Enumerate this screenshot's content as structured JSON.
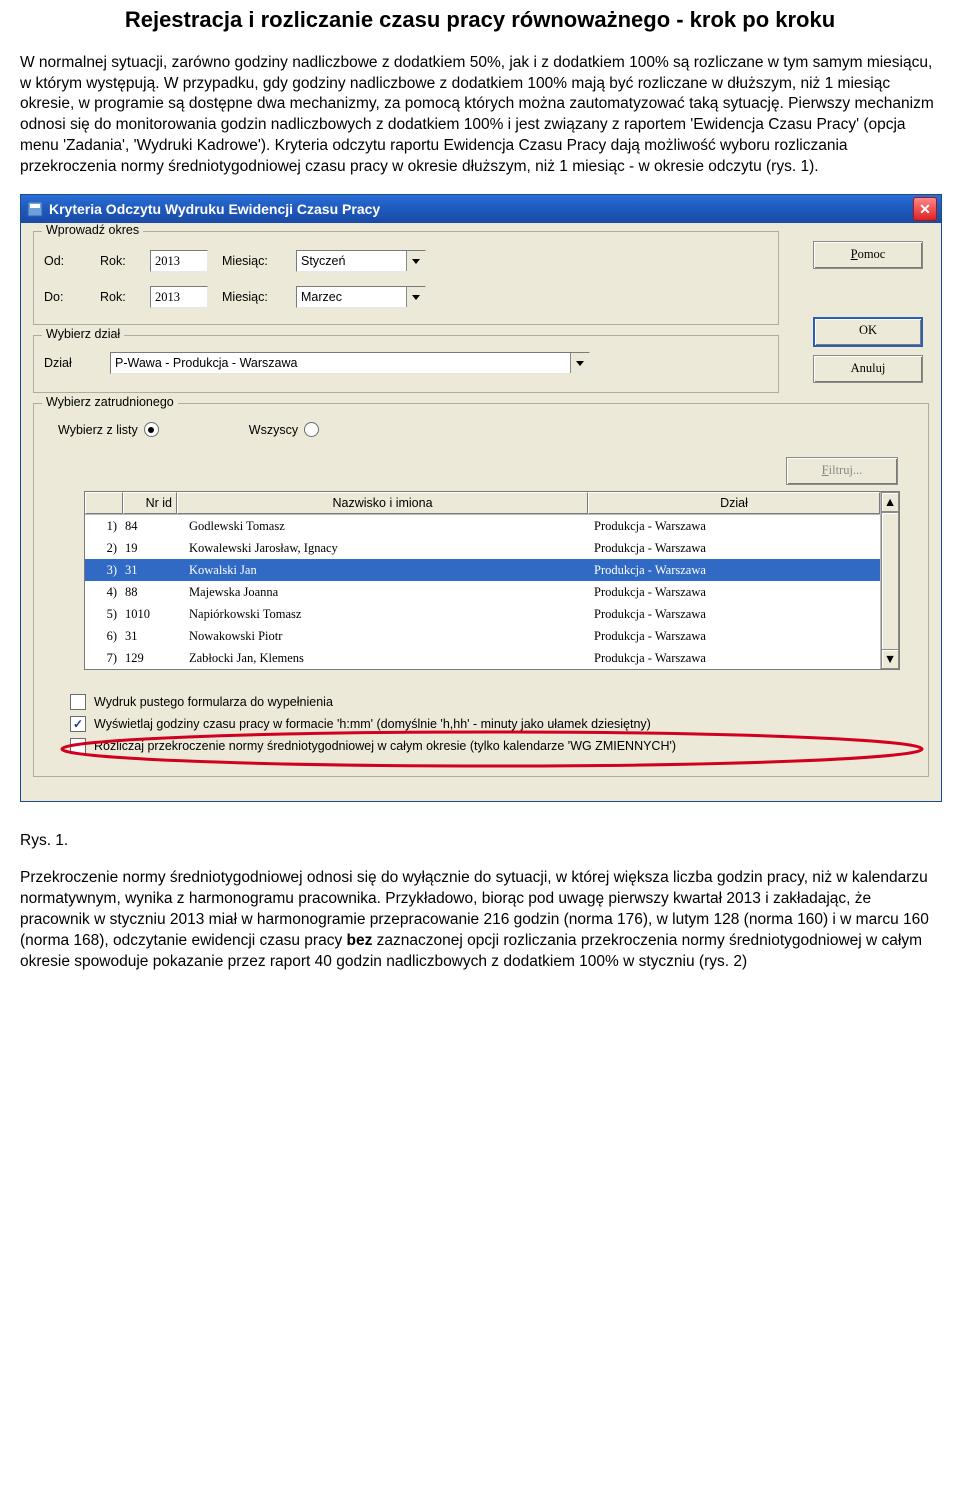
{
  "doc": {
    "title": "Rejestracja i rozliczanie czasu pracy równoważnego - krok po kroku",
    "paragraph1": "W normalnej sytuacji, zarówno godziny nadliczbowe z dodatkiem 50%, jak i z dodatkiem 100% są rozliczane w tym samym miesiącu, w którym występują. W przypadku, gdy godziny nadliczbowe z dodatkiem 100% mają być rozliczane w dłuższym, niż 1 miesiąc okresie, w programie są dostępne dwa mechanizmy, za pomocą których można zautomatyzować taką sytuację. Pierwszy mechanizm odnosi się do monitorowania godzin nadliczbowych z dodatkiem 100% i jest związany z raportem 'Ewidencja Czasu Pracy' (opcja menu 'Zadania', 'Wydruki Kadrowe'). Kryteria odczytu raportu Ewidencja Czasu Pracy dają możliwość wyboru rozliczania przekroczenia normy średniotygodniowej czasu pracy w okresie dłuższym, niż 1 miesiąc - w okresie odczytu (rys. 1).",
    "fig_caption": "Rys. 1.",
    "paragraph2_a": "Przekroczenie normy średniotygodniowej odnosi się do wyłącznie do sytuacji, w której większa liczba godzin pracy, niż w kalendarzu normatywnym, wynika z harmonogramu pracownika. Przykładowo, biorąc pod uwagę pierwszy kwartał 2013 i zakładając, że pracownik w styczniu 2013 miał w harmonogramie przepracowanie 216 godzin (norma 176), w lutym 128 (norma 160) i w marcu 160 (norma 168), odczytanie ewidencji czasu pracy ",
    "paragraph2_bold": "bez",
    "paragraph2_b": " zaznaczonej opcji rozliczania przekroczenia normy średniotygodniowej w całym okresie spowoduje pokazanie przez raport 40 godzin nadliczbowych z dodatkiem 100% w styczniu (rys. 2)"
  },
  "dialog": {
    "title": "Kryteria Odczytu Wydruku Ewidencji Czasu Pracy",
    "buttons": {
      "help": "Pomoc",
      "ok": "OK",
      "cancel": "Anuluj",
      "filter": "Filtruj..."
    },
    "period": {
      "legend": "Wprowadź okres",
      "from_label": "Od:",
      "to_label": "Do:",
      "year_label": "Rok:",
      "month_label": "Miesiąc:",
      "from_year": "2013",
      "from_month": "Styczeń",
      "to_year": "2013",
      "to_month": "Marzec"
    },
    "dept": {
      "legend": "Wybierz dział",
      "label": "Dział",
      "value": "P-Wawa - Produkcja - Warszawa"
    },
    "employee": {
      "legend": "Wybierz zatrudnionego",
      "radio_list": "Wybierz z listy",
      "radio_all": "Wszyscy",
      "headers": {
        "num": "",
        "id": "Nr id",
        "name": "Nazwisko i imiona",
        "dept": "Dział"
      },
      "rows": [
        {
          "num": "1)",
          "id": "84",
          "name": "Godlewski Tomasz",
          "dept": "Produkcja - Warszawa",
          "selected": false
        },
        {
          "num": "2)",
          "id": "19",
          "name": "Kowalewski Jarosław, Ignacy",
          "dept": "Produkcja - Warszawa",
          "selected": false
        },
        {
          "num": "3)",
          "id": "31",
          "name": "Kowalski Jan",
          "dept": "Produkcja - Warszawa",
          "selected": true
        },
        {
          "num": "4)",
          "id": "88",
          "name": "Majewska Joanna",
          "dept": "Produkcja - Warszawa",
          "selected": false
        },
        {
          "num": "5)",
          "id": "1010",
          "name": "Napiórkowski Tomasz",
          "dept": "Produkcja - Warszawa",
          "selected": false
        },
        {
          "num": "6)",
          "id": "31",
          "name": "Nowakowski Piotr",
          "dept": "Produkcja - Warszawa",
          "selected": false
        },
        {
          "num": "7)",
          "id": "129",
          "name": "Zabłocki Jan, Klemens",
          "dept": "Produkcja - Warszawa",
          "selected": false
        }
      ]
    },
    "checks": {
      "blank_form": {
        "label": "Wydruk pustego formularza do wypełnienia",
        "checked": false
      },
      "hmm_format": {
        "label": "Wyświetlaj godziny czasu pracy w formacie 'h:mm' (domyślnie 'h,hh' - minuty jako ułamek dziesiętny)",
        "checked": true
      },
      "avg_weekly": {
        "label": "Rozliczaj przekroczenie normy średniotygodniowej w całym okresie (tylko kalendarze 'WG ZMIENNYCH')",
        "checked": false
      }
    }
  }
}
